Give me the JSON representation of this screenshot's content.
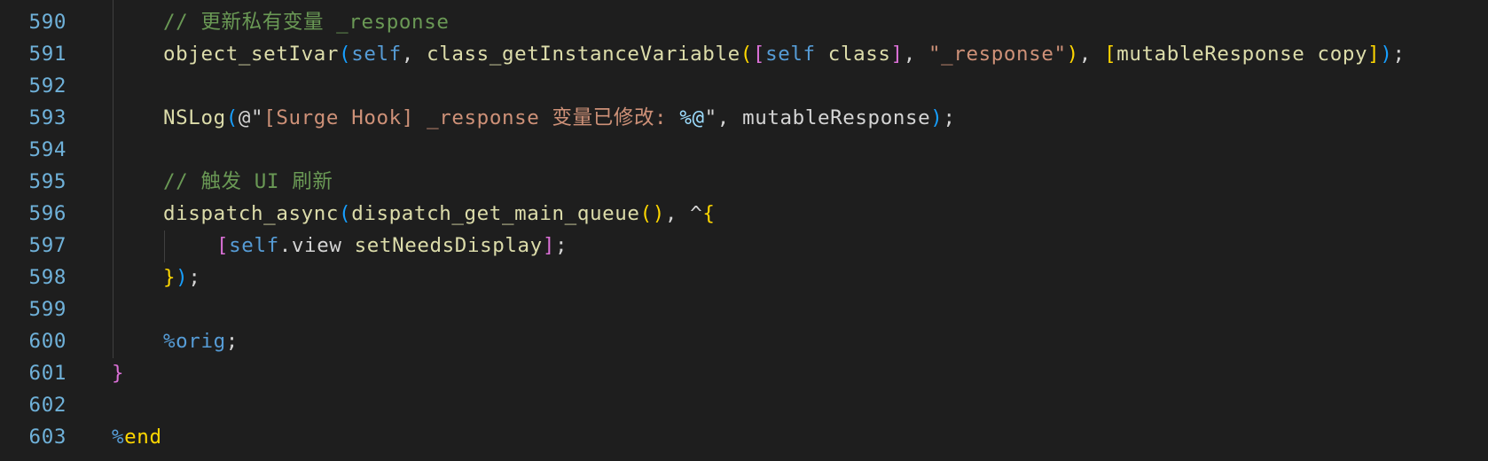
{
  "editor": {
    "lines": [
      {
        "num": "590",
        "tokens": [
          {
            "t": "// 更新私有变量 _response",
            "c": "c-comment"
          }
        ]
      },
      {
        "num": "591",
        "tokens": [
          {
            "t": "object_setIvar",
            "c": "c-func"
          },
          {
            "t": "(",
            "c": "b3"
          },
          {
            "t": "self",
            "c": "c-kw"
          },
          {
            "t": ", ",
            "c": "c-text"
          },
          {
            "t": "class_getInstanceVariable",
            "c": "c-func"
          },
          {
            "t": "(",
            "c": "b1"
          },
          {
            "t": "[",
            "c": "b2"
          },
          {
            "t": "self",
            "c": "c-kw"
          },
          {
            "t": " class",
            "c": "c-func"
          },
          {
            "t": "]",
            "c": "b2"
          },
          {
            "t": ", ",
            "c": "c-text"
          },
          {
            "t": "\"_response\"",
            "c": "c-str"
          },
          {
            "t": ")",
            "c": "b1"
          },
          {
            "t": ", ",
            "c": "c-text"
          },
          {
            "t": "[",
            "c": "b1"
          },
          {
            "t": "mutableResponse copy",
            "c": "c-func"
          },
          {
            "t": "]",
            "c": "b1"
          },
          {
            "t": ")",
            "c": "b3"
          },
          {
            "t": ";",
            "c": "c-text"
          }
        ]
      },
      {
        "num": "592",
        "tokens": []
      },
      {
        "num": "593",
        "tokens": [
          {
            "t": "NSLog",
            "c": "c-func"
          },
          {
            "t": "(",
            "c": "b3"
          },
          {
            "t": "@\"",
            "c": "c-text"
          },
          {
            "t": "[Surge Hook] _response 变量已修改: ",
            "c": "c-str"
          },
          {
            "t": "%@",
            "c": "c-fmt"
          },
          {
            "t": "\"",
            "c": "c-text"
          },
          {
            "t": ", mutableResponse",
            "c": "c-text"
          },
          {
            "t": ")",
            "c": "b3"
          },
          {
            "t": ";",
            "c": "c-text"
          }
        ]
      },
      {
        "num": "594",
        "tokens": []
      },
      {
        "num": "595",
        "tokens": [
          {
            "t": "// 触发 UI 刷新",
            "c": "c-comment"
          }
        ]
      },
      {
        "num": "596",
        "tokens": [
          {
            "t": "dispatch_async",
            "c": "c-func"
          },
          {
            "t": "(",
            "c": "b3"
          },
          {
            "t": "dispatch_get_main_queue",
            "c": "c-func"
          },
          {
            "t": "()",
            "c": "b1"
          },
          {
            "t": ", ^",
            "c": "c-text"
          },
          {
            "t": "{",
            "c": "b1"
          }
        ]
      },
      {
        "num": "597",
        "tokens": [
          {
            "t": "[",
            "c": "b2"
          },
          {
            "t": "self",
            "c": "c-kw"
          },
          {
            "t": ".view ",
            "c": "c-text"
          },
          {
            "t": "setNeedsDisplay",
            "c": "c-func"
          },
          {
            "t": "]",
            "c": "b2"
          },
          {
            "t": ";",
            "c": "c-text"
          }
        ]
      },
      {
        "num": "598",
        "tokens": [
          {
            "t": "}",
            "c": "b1"
          },
          {
            "t": ")",
            "c": "b3"
          },
          {
            "t": ";",
            "c": "c-text"
          }
        ]
      },
      {
        "num": "599",
        "tokens": []
      },
      {
        "num": "600",
        "tokens": [
          {
            "t": "%orig",
            "c": "c-kw"
          },
          {
            "t": ";",
            "c": "c-text"
          }
        ]
      },
      {
        "num": "601",
        "tokens": [
          {
            "t": "}",
            "c": "b2"
          }
        ]
      },
      {
        "num": "602",
        "tokens": []
      },
      {
        "num": "603",
        "tokens": [
          {
            "t": "%",
            "c": "c-kw"
          },
          {
            "t": "end",
            "c": "b1"
          }
        ]
      }
    ]
  }
}
